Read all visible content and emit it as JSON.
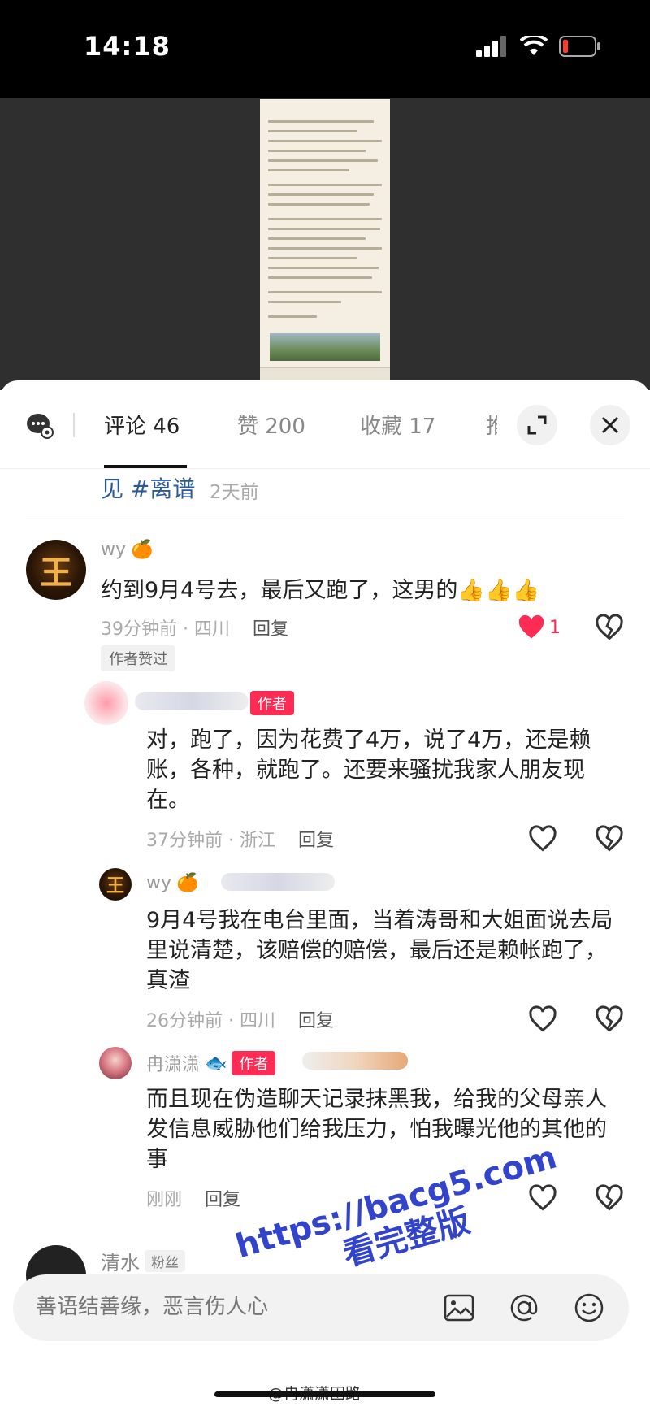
{
  "status_bar": {
    "time": "14:18"
  },
  "tabs": {
    "comments": "评论 46",
    "likes": "赞 200",
    "favorites": "收藏 17",
    "share_partial": "推"
  },
  "post_tail": {
    "text": "见 #离谱",
    "time": "2天前"
  },
  "comments": [
    {
      "user": "wy",
      "user_emoji": "🍊",
      "text": "约到9月4号去，最后又跑了，这男的👍👍👍",
      "time": "39分钟前 · 四川",
      "reply": "回复",
      "like_count": "1",
      "liked_badge": "作者赞过"
    },
    {
      "author_badge": "作者",
      "text": "对，跑了，因为花费了4万，说了4万，还是赖账，各种，就跑了。还要来骚扰我家人朋友现在。",
      "time": "37分钟前 · 浙江",
      "reply": "回复"
    },
    {
      "user": "wy",
      "user_emoji": "🍊",
      "text": "9月4号我在电台里面，当着涛哥和大姐面说去局里说清楚，该赔偿的赔偿，最后还是赖帐跑了，真渣",
      "time": "26分钟前 · 四川",
      "reply": "回复"
    },
    {
      "user": "冉潇潇",
      "user_emoji": "🐟",
      "author_badge": "作者",
      "text": "而且现在伪造聊天记录抹黑我，给我的父母亲人发信息威胁他们给我压力，怕我曝光他的其他的事",
      "time": "刚刚",
      "reply": "回复"
    },
    {
      "user": "清水",
      "fans_badge": "粉丝"
    }
  ],
  "input": {
    "placeholder": "善语结善缘，恶言伤人心"
  },
  "watermark": {
    "line1": "https://bacg5.com",
    "line2": "看完整版"
  },
  "footer": {
    "mark": "@冉潇潇困路"
  },
  "colors": {
    "accent": "#fe2c55",
    "hashtag": "#2a5a9a"
  }
}
